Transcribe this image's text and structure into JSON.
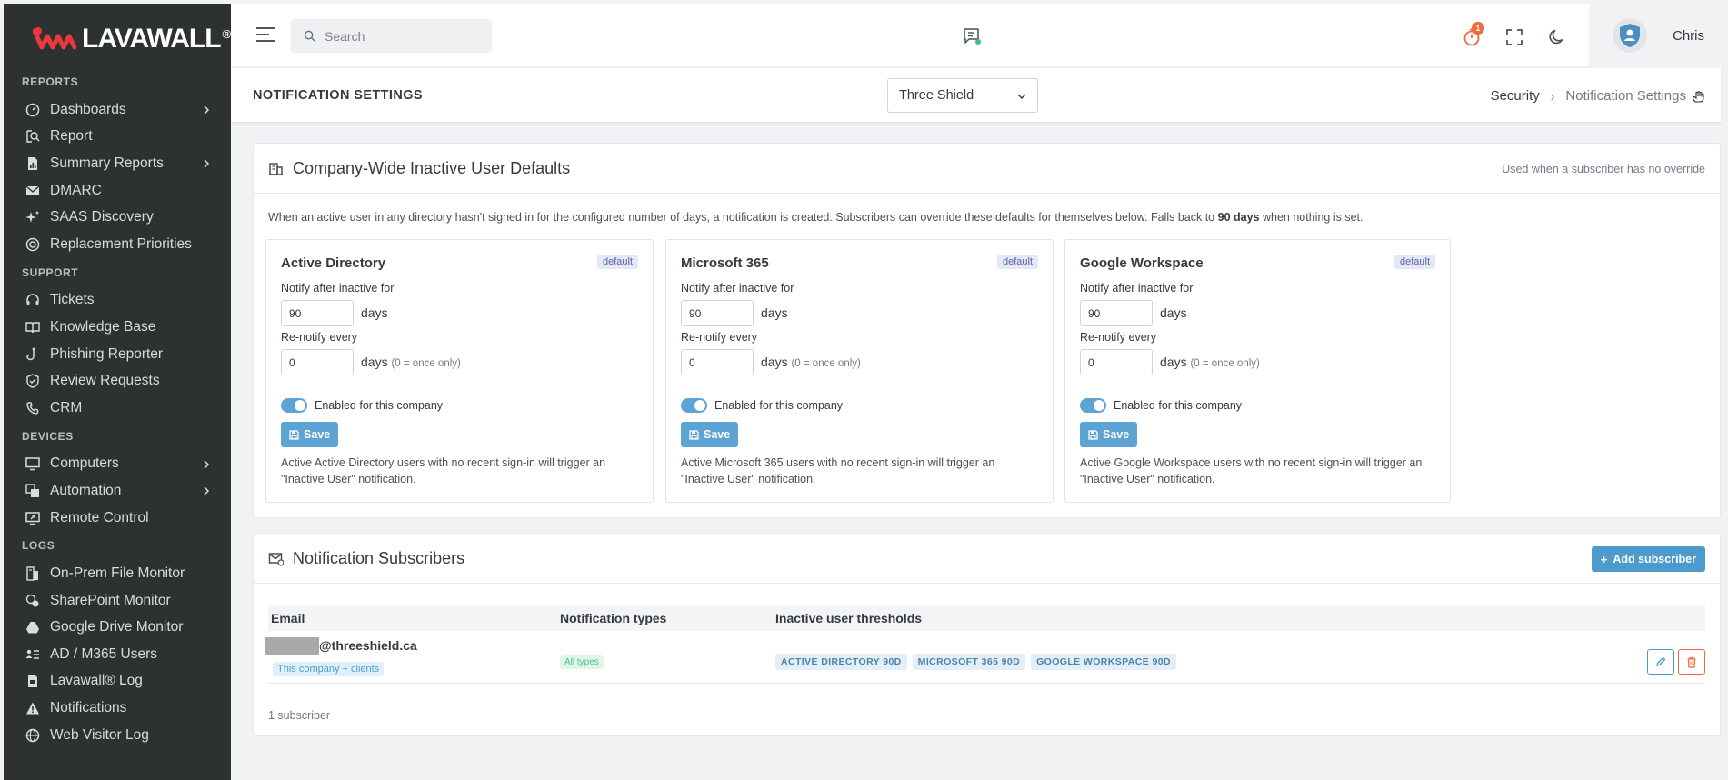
{
  "brand": {
    "name": "LAVAWALL",
    "reg": "®"
  },
  "sidebar": {
    "sections": [
      {
        "title": "REPORTS",
        "items": [
          {
            "label": "Dashboards",
            "icon": "gauge-icon",
            "chevron": true
          },
          {
            "label": "Report",
            "icon": "report-search-icon",
            "chevron": false
          },
          {
            "label": "Summary Reports",
            "icon": "file-chart-icon",
            "chevron": true
          },
          {
            "label": "DMARC",
            "icon": "mail-check-icon",
            "chevron": false
          },
          {
            "label": "SAAS Discovery",
            "icon": "sparkles-icon",
            "chevron": false
          },
          {
            "label": "Replacement Priorities",
            "icon": "target-icon",
            "chevron": false
          }
        ]
      },
      {
        "title": "SUPPORT",
        "items": [
          {
            "label": "Tickets",
            "icon": "headset-icon",
            "chevron": false
          },
          {
            "label": "Knowledge Base",
            "icon": "book-icon",
            "chevron": false
          },
          {
            "label": "Phishing Reporter",
            "icon": "hook-icon",
            "chevron": false
          },
          {
            "label": "Review Requests",
            "icon": "shield-check-icon",
            "chevron": false
          },
          {
            "label": "CRM",
            "icon": "phone-book-icon",
            "chevron": false
          }
        ]
      },
      {
        "title": "DEVICES",
        "items": [
          {
            "label": "Computers",
            "icon": "monitor-icon",
            "chevron": true
          },
          {
            "label": "Automation",
            "icon": "automation-icon",
            "chevron": true
          },
          {
            "label": "Remote Control",
            "icon": "remote-desktop-icon",
            "chevron": false
          }
        ]
      },
      {
        "title": "LOGS",
        "items": [
          {
            "label": "On-Prem File Monitor",
            "icon": "file-server-icon",
            "chevron": false
          },
          {
            "label": "SharePoint Monitor",
            "icon": "sharepoint-icon",
            "chevron": false
          },
          {
            "label": "Google Drive Monitor",
            "icon": "drive-icon",
            "chevron": false
          },
          {
            "label": "AD / M365 Users",
            "icon": "users-list-icon",
            "chevron": false
          },
          {
            "label": "Lavawall® Log",
            "icon": "log-file-icon",
            "chevron": false
          },
          {
            "label": "Notifications",
            "icon": "warning-icon",
            "chevron": false
          },
          {
            "label": "Web Visitor Log",
            "icon": "globe-icon",
            "chevron": false
          }
        ]
      }
    ]
  },
  "topbar": {
    "search_placeholder": "Search",
    "timer_badge": "1",
    "user_name": "Chris"
  },
  "subheader": {
    "title": "NOTIFICATION SETTINGS",
    "company": "Three Shield",
    "breadcrumb": [
      "Security",
      "Notification Settings"
    ]
  },
  "defaults_card": {
    "title": "Company-Wide Inactive User Defaults",
    "note": "Used when a subscriber has no override",
    "description_pre": "When an active user in any directory hasn't signed in for the configured number of days, a notification is created. Subscribers can override these defaults for themselves below. Falls back to",
    "description_bold": "90 days",
    "description_post": "when nothing is set.",
    "directories": [
      {
        "name": "Active Directory",
        "badge": "default",
        "notify_label": "Notify after inactive for",
        "notify_days": "90",
        "days_unit": "days",
        "renotify_label": "Re-notify every",
        "renotify_days": "0",
        "renotify_hint": "(0 = once only)",
        "toggle_label": "Enabled for this company",
        "enabled": true,
        "save_label": "Save",
        "note": "Active Active Directory users with no recent sign-in will trigger an \"Inactive User\" notification."
      },
      {
        "name": "Microsoft 365",
        "badge": "default",
        "notify_label": "Notify after inactive for",
        "notify_days": "90",
        "days_unit": "days",
        "renotify_label": "Re-notify every",
        "renotify_days": "0",
        "renotify_hint": "(0 = once only)",
        "toggle_label": "Enabled for this company",
        "enabled": true,
        "save_label": "Save",
        "note": "Active Microsoft 365 users with no recent sign-in will trigger an \"Inactive User\" notification."
      },
      {
        "name": "Google Workspace",
        "badge": "default",
        "notify_label": "Notify after inactive for",
        "notify_days": "90",
        "days_unit": "days",
        "renotify_label": "Re-notify every",
        "renotify_days": "0",
        "renotify_hint": "(0 = once only)",
        "toggle_label": "Enabled for this company",
        "enabled": true,
        "save_label": "Save",
        "note": "Active Google Workspace users with no recent sign-in will trigger an \"Inactive User\" notification."
      }
    ]
  },
  "subscribers_card": {
    "title": "Notification Subscribers",
    "add_label": "Add subscriber",
    "columns": [
      "Email",
      "Notification types",
      "Inactive user thresholds"
    ],
    "rows": [
      {
        "email_domain": "@threeshield.ca",
        "scope": "This company + clients",
        "types": "All types",
        "thresholds": [
          "ACTIVE DIRECTORY 90D",
          "MICROSOFT 365 90D",
          "GOOGLE WORKSPACE 90D"
        ]
      }
    ],
    "count_text": "1 subscriber"
  },
  "colors": {
    "sidebar_bg": "#2d3230",
    "accent": "#5da3d4",
    "danger": "#ef6a3d",
    "success": "#4cc28a",
    "logo_red": "#e8393f"
  }
}
